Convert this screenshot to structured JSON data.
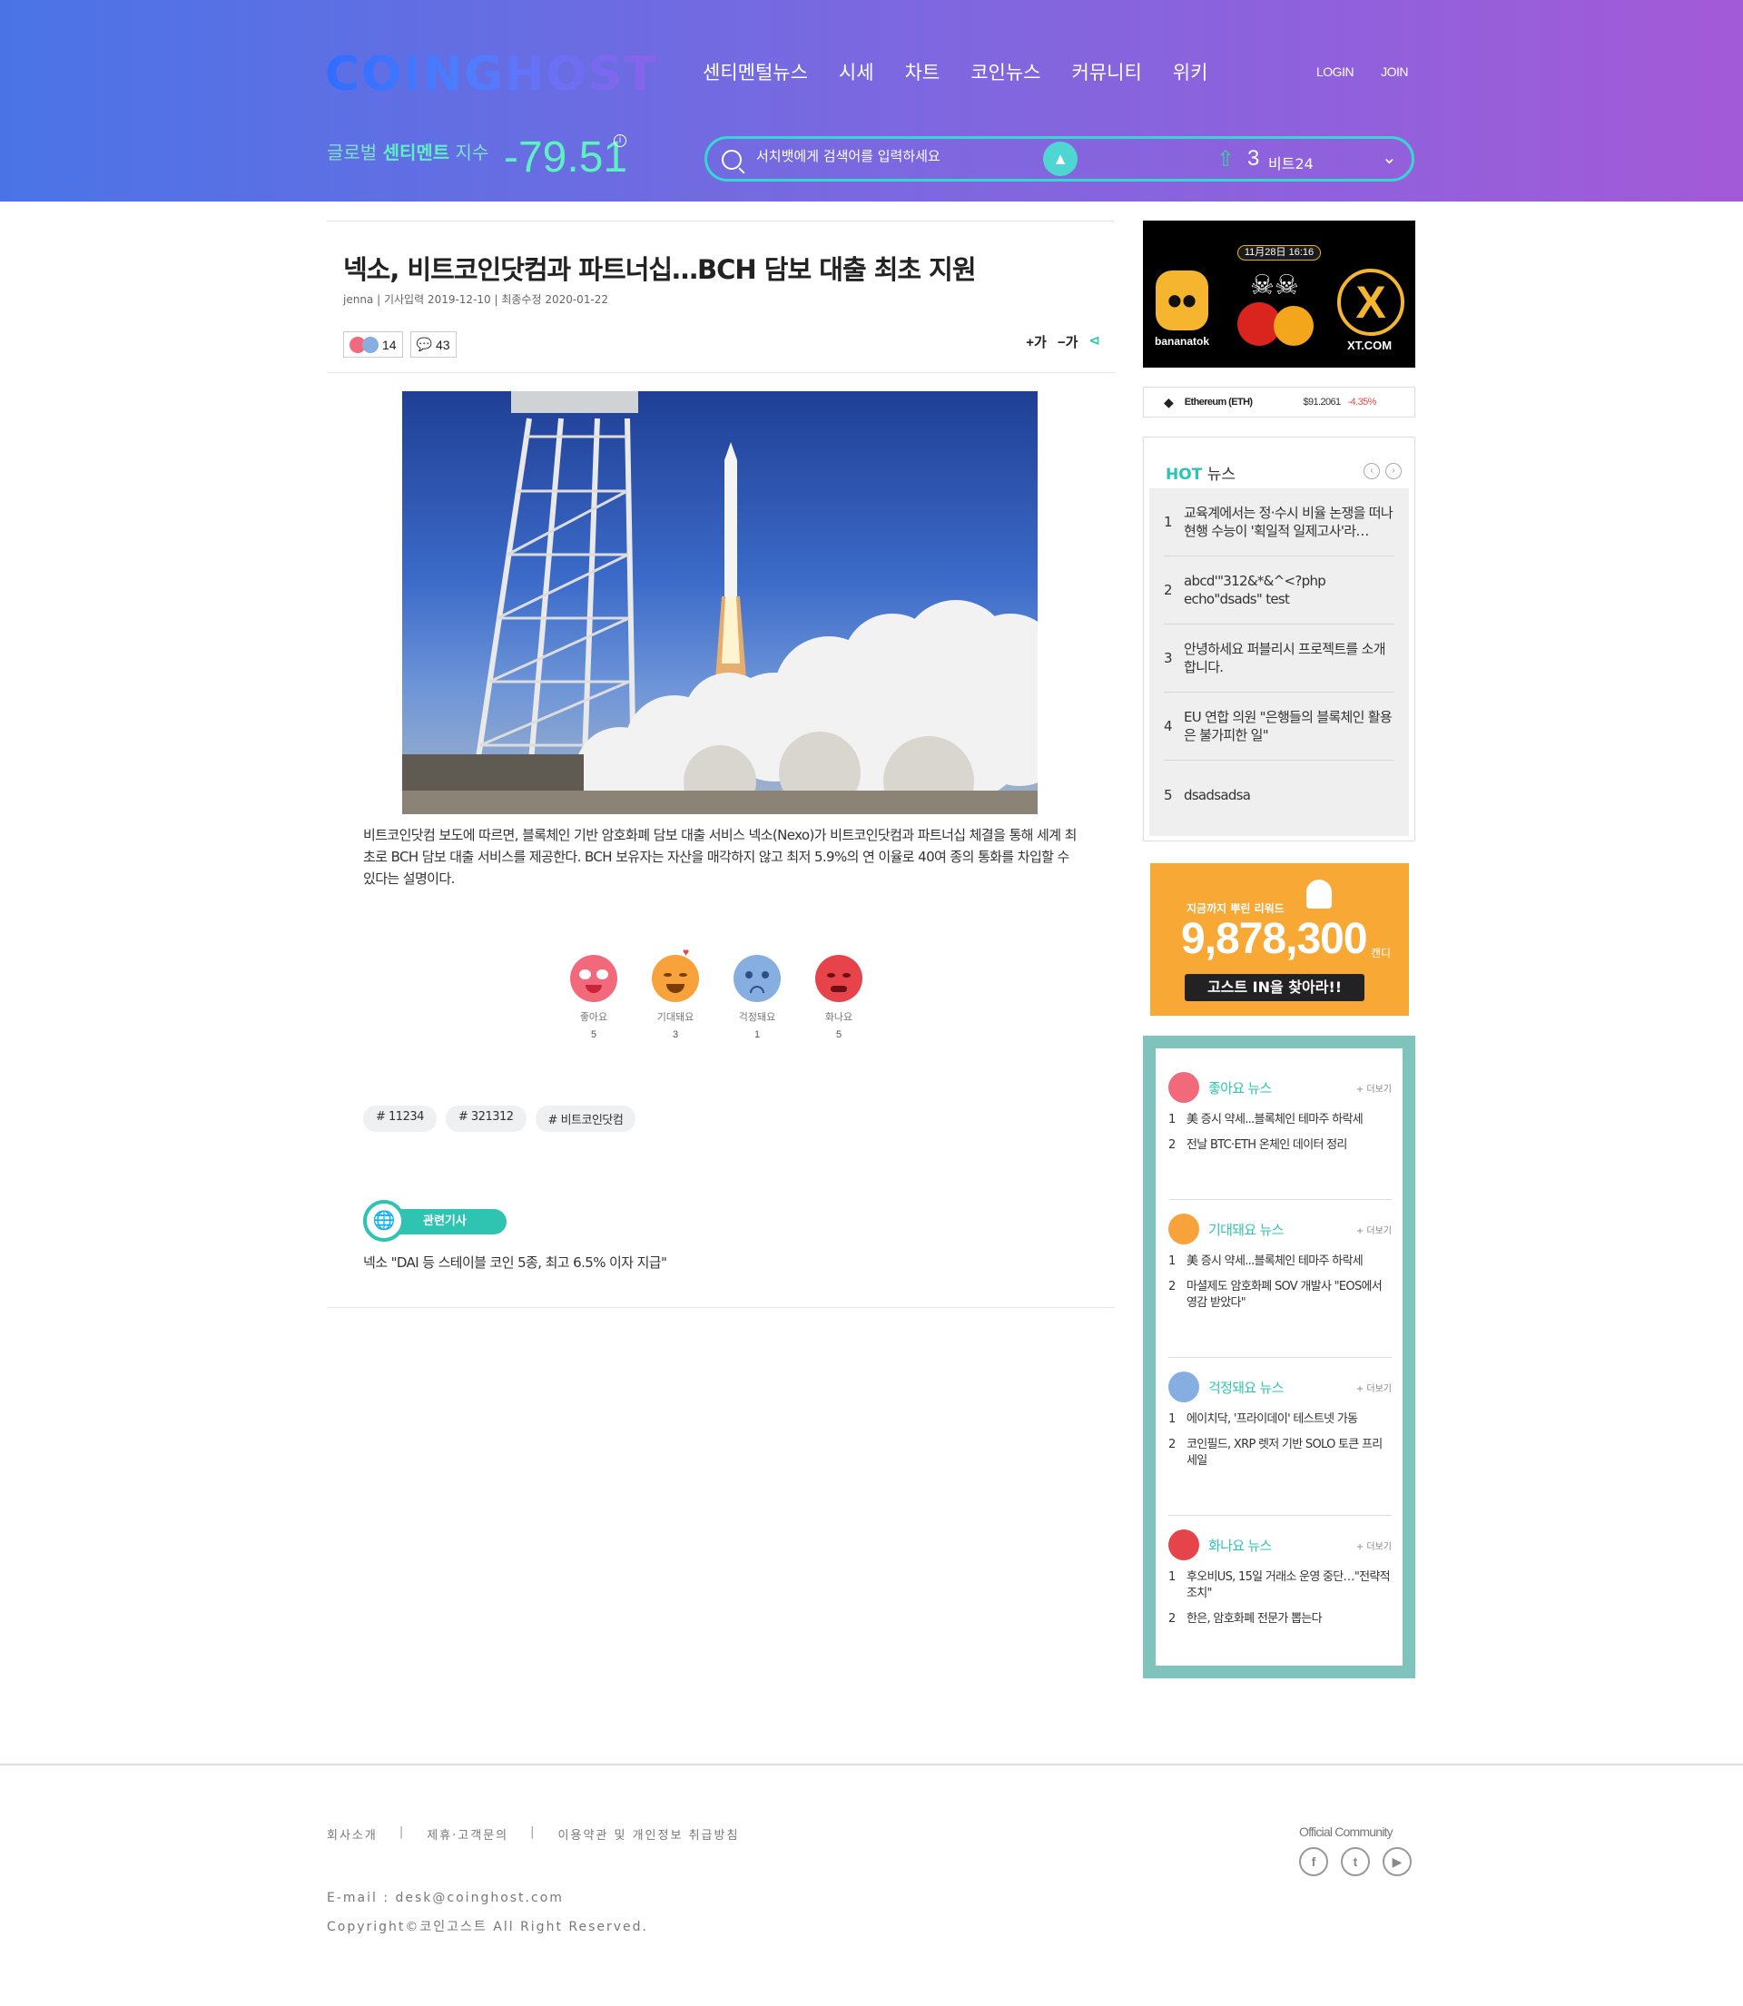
{
  "header": {
    "logo": "COINGHOST",
    "nav": [
      "센티멘털뉴스",
      "시세",
      "차트",
      "코인뉴스",
      "커뮤니티",
      "위키"
    ],
    "login": "LOGIN",
    "join": "JOIN",
    "sentiment_prefix": "글로벌",
    "sentiment_strong": "센티멘트",
    "sentiment_suffix": "지수",
    "sentiment_value": "-79.51",
    "search_placeholder": "서치뱃에게 검색어를 입력하세요",
    "rank_number": "3",
    "rank_label": "비트24"
  },
  "article": {
    "title": "넥소, 비트코인닷컴과 파트너십…BCH 담보 대출 최초 지원",
    "meta": "jenna | 기사입력 2019-12-10 | 최종수정 2020-01-22",
    "reaction_count": "14",
    "comment_count": "43",
    "font_up": "+가",
    "font_down": "−가",
    "body": "비트코인닷컴 보도에 따르면, 블록체인 기반 암호화폐 담보 대출 서비스 넥소(Nexo)가 비트코인닷컴과 파트너십 체결을 통해 세계 최초로 BCH 담보 대출 서비스를 제공한다. BCH 보유자는 자산을 매각하지 않고 최저 5.9%의 연 이율로 40여 종의 통화를 차입할 수 있다는 설명이다.",
    "emotions": [
      {
        "label": "좋아요",
        "count": "5",
        "color": "#f2697c"
      },
      {
        "label": "기대돼요",
        "count": "3",
        "color": "#f7a23a"
      },
      {
        "label": "걱정돼요",
        "count": "1",
        "color": "#86aee0"
      },
      {
        "label": "화나요",
        "count": "5",
        "color": "#e6434b"
      }
    ],
    "tags": [
      "# 11234",
      "# 321312",
      "# 비트코인닷컴"
    ],
    "related_label": "관련기사",
    "related_link": "넥소 \"DAI 등 스테이블 코인 5종, 최고 6.5% 이자 지급\""
  },
  "sidebar": {
    "ad": {
      "date": "11月28日 16:16",
      "left_brand": "bananatok",
      "right_brand": "XT.COM"
    },
    "ticker": {
      "name": "Ethereum (ETH)",
      "price": "$91.2061",
      "change": "-4.35%"
    },
    "hot": {
      "title_strong": "HOT",
      "title_rest": "뉴스",
      "items": [
        {
          "n": "1",
          "text": "교육계에서는 정·수시 비율 논쟁을 떠나 현행 수능이 '획일적 일제고사'라…"
        },
        {
          "n": "2",
          "text": "abcd'\"312&*&^<?php echo\"dsads\" test"
        },
        {
          "n": "3",
          "text": "안녕하세요 퍼블리시 프로젝트를 소개합니다."
        },
        {
          "n": "4",
          "text": "EU 연합 의원 \"은행들의 블록체인 활용은 불가피한 일\""
        },
        {
          "n": "5",
          "text": "dsadsadsa"
        }
      ]
    },
    "reward": {
      "subtitle": "지금까지 뿌린 리워드",
      "amount": "9,878,300",
      "unit": "캔디",
      "button": "고스트 IN을 찾아라!!"
    },
    "emotion_news": [
      {
        "title": "좋아요 뉴스",
        "more": "+ 더보기",
        "color": "#f2697c",
        "items": [
          {
            "n": "1",
            "text": "美 증시 약세...블록체인 테마주 하락세"
          },
          {
            "n": "2",
            "text": "전날 BTC·ETH 온체인 데이터 정리"
          }
        ]
      },
      {
        "title": "기대돼요 뉴스",
        "more": "+ 더보기",
        "color": "#f7a23a",
        "items": [
          {
            "n": "1",
            "text": "美 증시 약세...블록체인 테마주 하락세"
          },
          {
            "n": "2",
            "text": "마셜제도 암호화폐 SOV 개발사 \"EOS에서 영감 받았다\""
          }
        ]
      },
      {
        "title": "걱정돼요 뉴스",
        "more": "+ 더보기",
        "color": "#86aee0",
        "items": [
          {
            "n": "1",
            "text": "에이치닥, '프라이데이' 테스트넷 가동"
          },
          {
            "n": "2",
            "text": "코인필드, XRP 렛저 기반 SOLO 토큰 프리세일"
          }
        ]
      },
      {
        "title": "화나요 뉴스",
        "more": "+ 더보기",
        "color": "#e6434b",
        "items": [
          {
            "n": "1",
            "text": "후오비US, 15일 거래소 운영 중단…\"전략적 조치\""
          },
          {
            "n": "2",
            "text": "한은, 암호화폐 전문가 뽑는다"
          }
        ]
      }
    ]
  },
  "footer": {
    "links": [
      "회사소개",
      "제휴·고객문의",
      "이용약관 및 개인정보 취급방침"
    ],
    "email": "E-mail : desk@coinghost.com",
    "copyright": "Copyright©코인고스트 All Right Reserved.",
    "community": "Official Community",
    "social": [
      "facebook",
      "twitter",
      "youtube"
    ]
  }
}
